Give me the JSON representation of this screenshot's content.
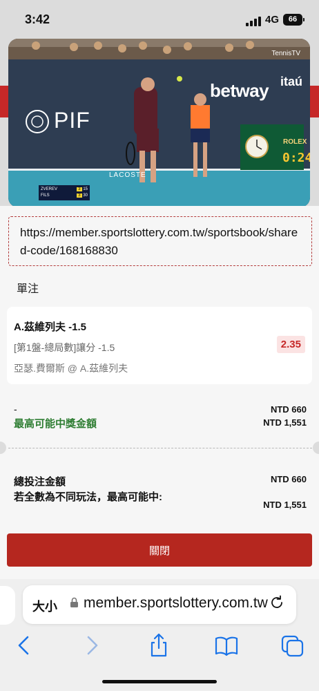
{
  "status": {
    "time": "3:42",
    "network": "4G",
    "battery": "66"
  },
  "video": {
    "channel_logo": "TennisTV",
    "sponsors": [
      "betway",
      "itaú",
      "PIF",
      "ROLEX",
      "LACOSTE"
    ],
    "clock": "0:24",
    "scoreboard": {
      "rows": [
        {
          "player": "ZVEREV",
          "set": "3",
          "game": "15"
        },
        {
          "player": "FILS",
          "set": "3",
          "game": "30"
        }
      ]
    }
  },
  "share_link": "https://member.sportslottery.com.tw/sportsbook/shared-code/168168830",
  "section_title": "單注",
  "bet": {
    "selection": "A.茲維列夫 -1.5",
    "market": "[第1盤-總局數]讓分 -1.5",
    "match": "亞瑟.費爾斯 @ A.茲維列夫",
    "odds": "2.35"
  },
  "summary": {
    "dash_label": "-",
    "stake": "NTD 660",
    "max_win_label": "最高可能中獎金額",
    "max_win": "NTD 1,551",
    "total_label": "總投注金額",
    "total": "NTD 660",
    "multi_label": "若全數為不同玩法，最高可能中:",
    "multi_value": "NTD 1,551"
  },
  "close_button": "關閉",
  "browser": {
    "aa_label": "大小",
    "url": "member.sportslottery.com.tw",
    "nav_icons": [
      "back-icon",
      "forward-icon",
      "share-icon",
      "bookmarks-icon",
      "tabs-icon"
    ]
  },
  "colors": {
    "accent_red": "#b5271f",
    "green": "#2e7d32",
    "odds_bg": "#fbe3e3"
  }
}
